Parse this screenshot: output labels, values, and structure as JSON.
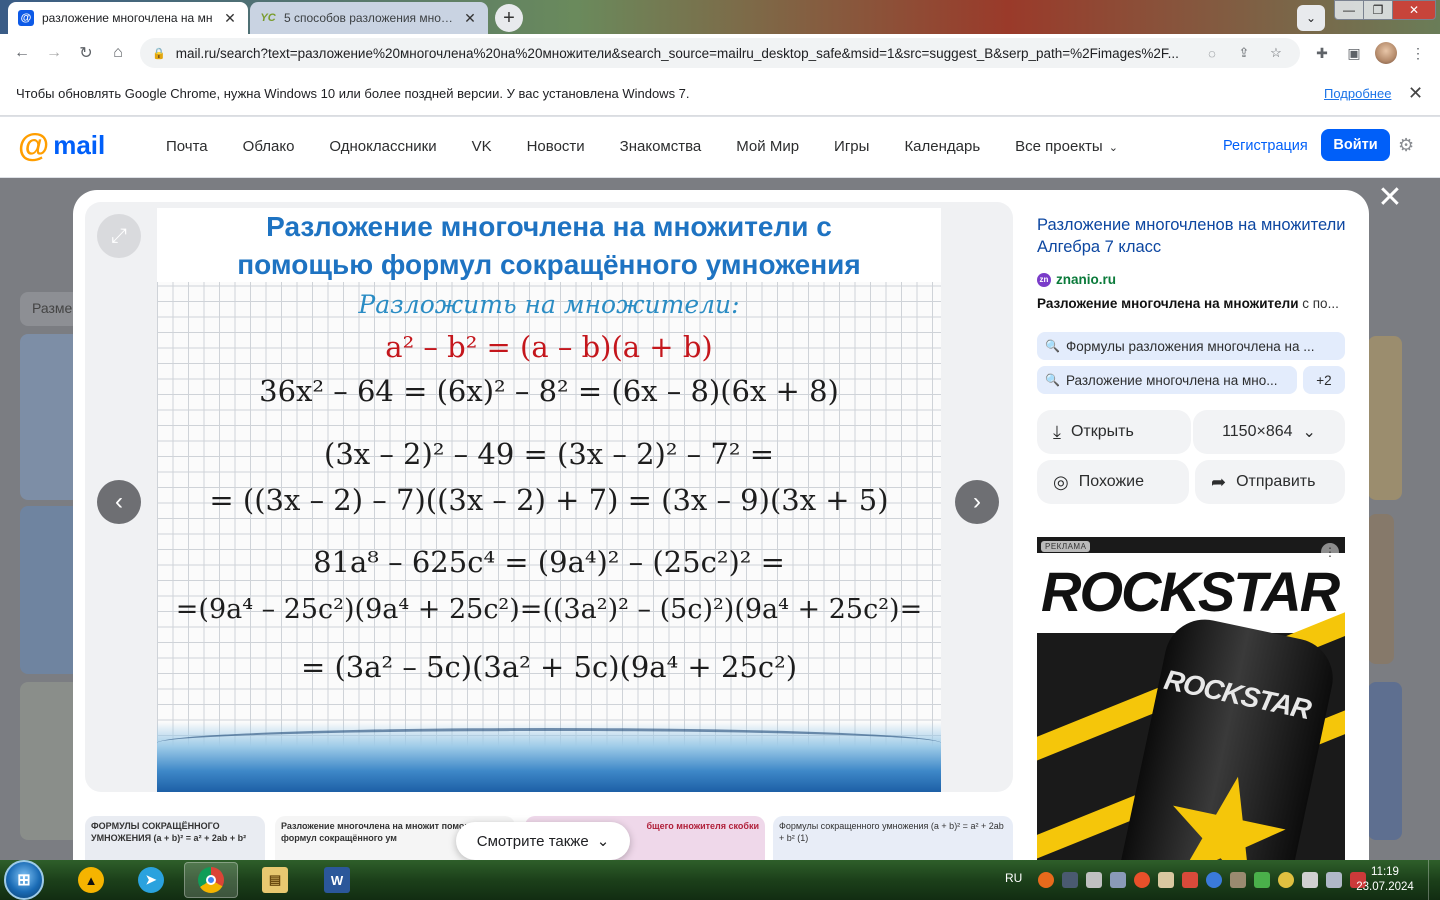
{
  "browser": {
    "tabs": [
      {
        "title": "разложение многочлена на мн",
        "favicon": "mailru-icon",
        "active": true
      },
      {
        "title": "5 способов разложения многоч",
        "favicon": "yc-icon",
        "active": false
      }
    ],
    "new_tab": "+",
    "url": "mail.ru/search?text=разложение%20многочлена%20на%20множители&search_source=mailru_desktop_safe&msid=1&src=suggest_B&serp_path=%2Fimages%2F...",
    "infobar": {
      "message": "Чтобы обновлять Google Chrome, нужна Windows 10 или более поздней версии. У вас установлена Windows 7.",
      "link": "Подробнее"
    }
  },
  "site": {
    "logo_at": "@",
    "logo_word": "mail",
    "nav": [
      "Почта",
      "Облако",
      "Одноклассники",
      "VK",
      "Новости",
      "Знакомства",
      "Мой Мир",
      "Игры",
      "Календарь",
      "Все проекты"
    ],
    "register": "Регистрация",
    "login": "Войти"
  },
  "background": {
    "search_stub": "Разме"
  },
  "viewer": {
    "slide": {
      "title_line1": "Разложение многочлена на множители с",
      "title_line2": "помощью формул сокращённого умножения",
      "subtitle": "Разложить на множители:",
      "formula": "a² – b² = (a – b)(a + b)",
      "lines": [
        "36x² – 64 = (6x)² – 8² = (6x – 8)(6x + 8)",
        "(3x – 2)² – 49 = (3x – 2)² – 7² =",
        "= ((3x – 2) – 7)((3x – 2) + 7) = (3x – 9)(3x + 5)",
        "81a⁸ – 625c⁴ = (9a⁴)² – (25c²)² =",
        "=(9a⁴ – 25c²)(9a⁴ + 25c²)=((3a²)² – (5c)²)(9a⁴ + 25c²)=",
        "= (3a² – 5c)(3a² + 5c)(9a⁴ + 25c²)"
      ]
    },
    "see_also": "Смотрите также",
    "thumbs": [
      {
        "text": "ФОРМУЛЫ СОКРАЩЁННОГО УМНОЖЕНИЯ (a + b)² = a² + 2ab + b²"
      },
      {
        "text": "Разложение многочлена на множит помощью формул сокращённого ум"
      },
      {
        "text": "бщего множителя скобки"
      },
      {
        "text": "Формулы сокращенного умножения (a + b)² = a² + 2ab + b² (1)"
      }
    ]
  },
  "info": {
    "title": "Разложение многочленов на множители Алгебра 7 класс",
    "source": "znanio.ru",
    "desc_bold": "Разложение многочлена на множители",
    "desc_rest": " с по...",
    "chips": [
      "Формулы разложения многочлена на ...",
      "Разложение многочлена на мно...",
      "+2"
    ],
    "open": "Открыть",
    "size": "1150×864",
    "similar": "Похожие",
    "send": "Отправить"
  },
  "ad": {
    "label": "РЕКЛАМА",
    "brand": "ROCKSTAR",
    "can_text": "ROCKSTAR"
  },
  "taskbar": {
    "lang": "RU",
    "time": "11:19",
    "date": "23.07.2024"
  },
  "colors": {
    "mail_blue": "#005ff9",
    "mail_orange": "#ff9e00",
    "slide_title": "#1e73c2",
    "formula_red": "#c4161c"
  }
}
